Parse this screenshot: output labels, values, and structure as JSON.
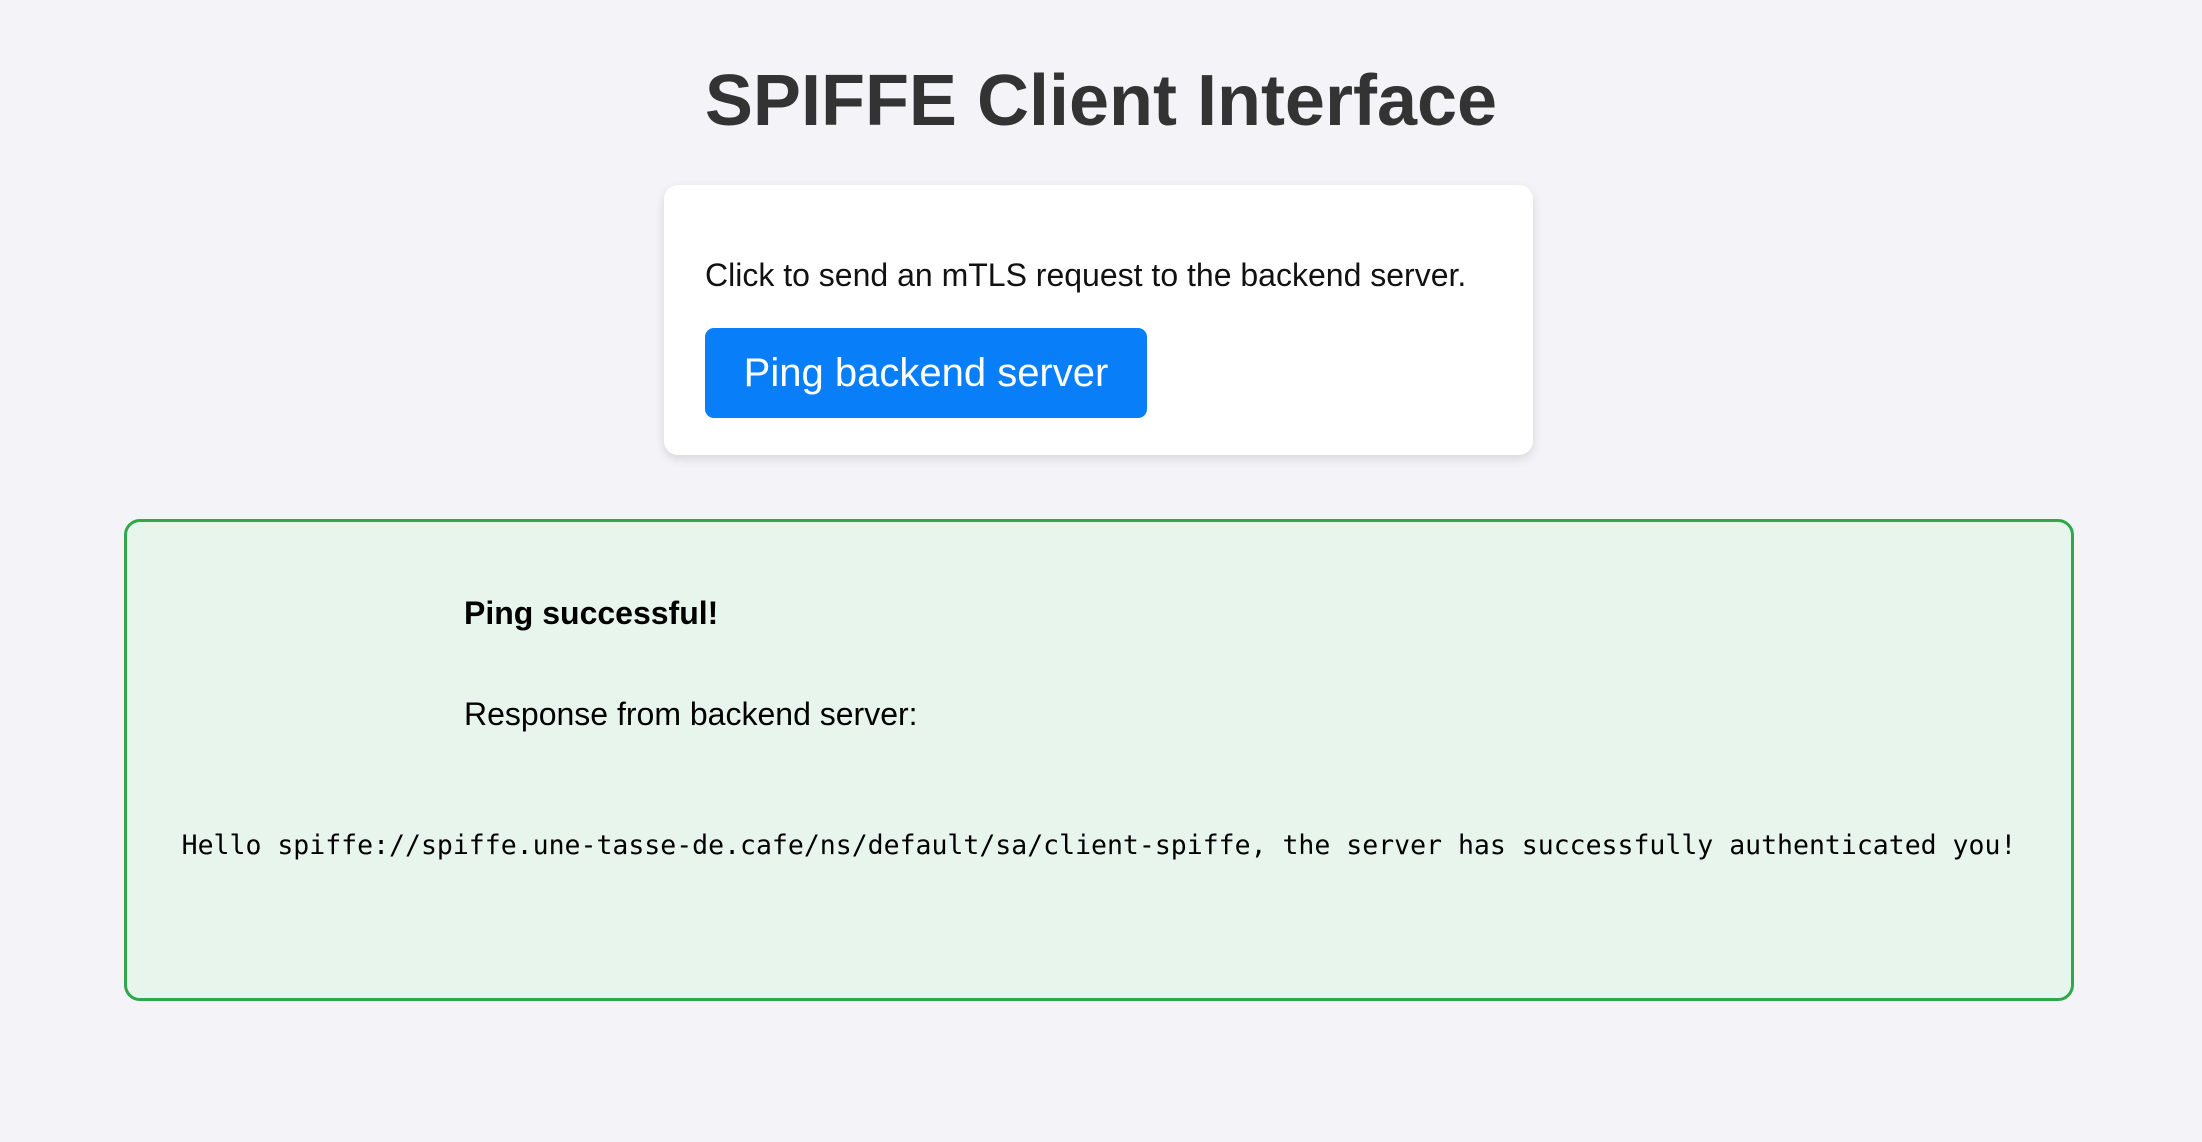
{
  "header": {
    "title": "SPIFFE Client Interface"
  },
  "card": {
    "instruction": "Click to send an mTLS request to the backend server.",
    "button_label": "Ping backend server"
  },
  "result": {
    "status": "Ping successful!",
    "label": "Response from backend server:",
    "message": "Hello spiffe://spiffe.une-tasse-de.cafe/ns/default/sa/client-spiffe, the server has successfully authenticated you!"
  },
  "colors": {
    "background": "#f4f4f8",
    "button": "#087ef9",
    "success_border": "#2ea84a",
    "success_background": "#e8f5ec",
    "title": "#333333"
  }
}
